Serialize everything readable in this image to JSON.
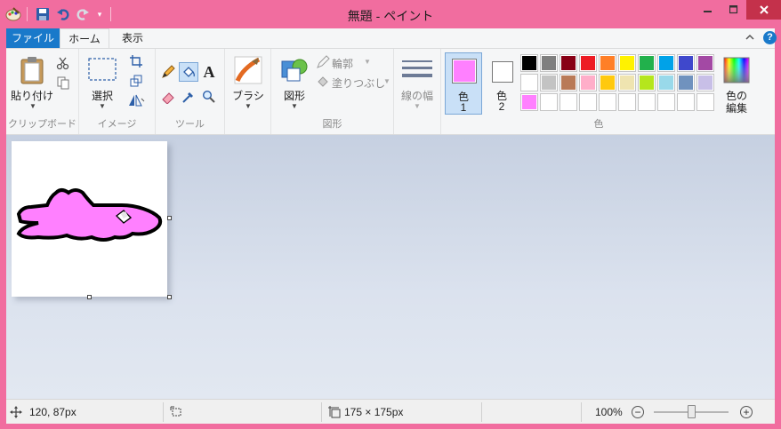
{
  "window": {
    "title": "無題 - ペイント",
    "accent": "#f16d9f",
    "close_color": "#c4314b"
  },
  "tabs": {
    "file": "ファイル",
    "home": "ホーム",
    "view": "表示"
  },
  "ribbon": {
    "clipboard": {
      "paste_label": "貼り付け",
      "group_label": "クリップボード"
    },
    "image": {
      "select_label": "選択",
      "group_label": "イメージ"
    },
    "tools": {
      "group_label": "ツール",
      "text_tool_glyph": "A"
    },
    "brushes": {
      "label": "ブラシ"
    },
    "shapes": {
      "label": "図形",
      "outline_label": "輪郭",
      "fill_label": "塗りつぶし",
      "group_label": "図形"
    },
    "size": {
      "label": "線の幅"
    },
    "colors": {
      "color1_label": "色",
      "color1_num": "1",
      "color2_label": "色",
      "color2_num": "2",
      "edit_label_1": "色の",
      "edit_label_2": "編集",
      "group_label": "色",
      "color1": "#ff80ff",
      "color2": "#ffffff",
      "palette_row1": [
        "#000000",
        "#7f7f7f",
        "#880015",
        "#ed1c24",
        "#ff7f27",
        "#fff200",
        "#22b14c",
        "#00a2e8",
        "#3f48cc",
        "#a349a4"
      ],
      "palette_row2": [
        "#ffffff",
        "#c3c3c3",
        "#b97a57",
        "#ffaec9",
        "#ffc90e",
        "#efe4b0",
        "#b5e61d",
        "#99d9ea",
        "#7092be",
        "#c8bfe7"
      ],
      "palette_row3": [
        "#ff80ff",
        "#ffffff",
        "#ffffff",
        "#ffffff",
        "#ffffff",
        "#ffffff",
        "#ffffff",
        "#ffffff",
        "#ffffff",
        "#ffffff"
      ]
    }
  },
  "canvas": {
    "blob_color": "#ff80ff",
    "outline_color": "#000000"
  },
  "status": {
    "cursor_pos": "120, 87px",
    "canvas_size": "175 × 175px",
    "zoom": "100%",
    "zoom_out": "−",
    "zoom_in": "+"
  }
}
